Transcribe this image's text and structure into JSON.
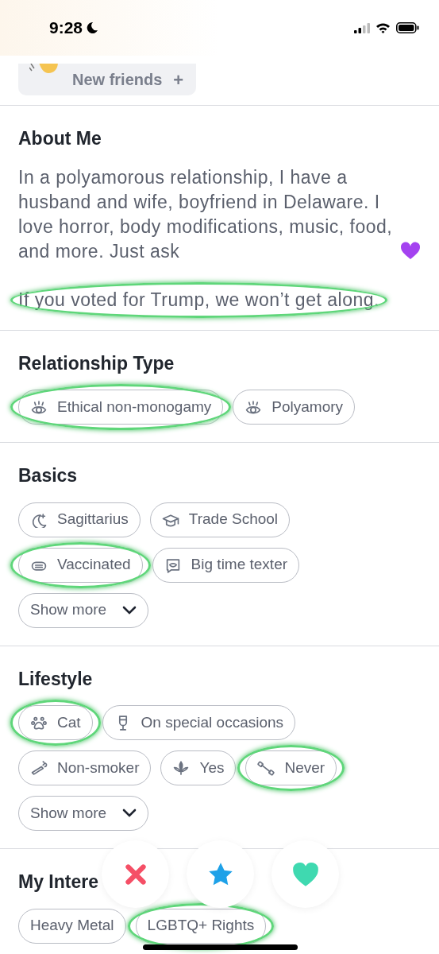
{
  "status_bar": {
    "time": "9:28"
  },
  "intent": {
    "label": "New friends",
    "plus": "+"
  },
  "sections": [
    {
      "kind": "about",
      "title": "About Me",
      "paragraphs": [
        {
          "kind": "text_with_heart",
          "text": "In a polyamorous relationship, I have a husband and wife, boyfriend in Delaware. I love horror, body modifications, music, food, and more. Just ask",
          "circled": false
        },
        {
          "kind": "text",
          "text": "If you voted for Trump, we won’t get along.",
          "circled": true
        }
      ]
    },
    {
      "kind": "chips",
      "title": "Relationship Type",
      "chips": [
        {
          "kind": "relationship",
          "label": "Ethical non-monogamy",
          "circled": true
        },
        {
          "kind": "relationship",
          "label": "Polyamory",
          "circled": false
        }
      ]
    },
    {
      "kind": "chips",
      "title": "Basics",
      "chips": [
        {
          "kind": "zodiac",
          "label": "Sagittarius",
          "circled": false
        },
        {
          "kind": "education",
          "label": "Trade School",
          "circled": false
        },
        {
          "kind": "vaccine",
          "label": "Vaccinated",
          "circled": true
        },
        {
          "kind": "communication",
          "label": "Big time texter",
          "circled": false
        },
        {
          "kind": "more",
          "label": "Show more",
          "circled": false
        }
      ]
    },
    {
      "kind": "chips",
      "title": "Lifestyle",
      "chips": [
        {
          "kind": "pet",
          "label": "Cat",
          "circled": true
        },
        {
          "kind": "drinking",
          "label": "On special occasions",
          "circled": false
        },
        {
          "kind": "smoking",
          "label": "Non-smoker",
          "circled": false
        },
        {
          "kind": "cannabis",
          "label": "Yes",
          "circled": false
        },
        {
          "kind": "workout",
          "label": "Never",
          "circled": true
        },
        {
          "kind": "more",
          "label": "Show more",
          "circled": false
        }
      ]
    },
    {
      "kind": "chips",
      "title": "My Intere",
      "chips": [
        {
          "kind": "plain",
          "label": "Heavy Metal",
          "circled": false
        },
        {
          "kind": "plain",
          "label": "LGBTQ+ Rights",
          "circled": true
        }
      ]
    }
  ],
  "actions": [
    {
      "kind": "nope"
    },
    {
      "kind": "super_like"
    },
    {
      "kind": "like"
    }
  ]
}
